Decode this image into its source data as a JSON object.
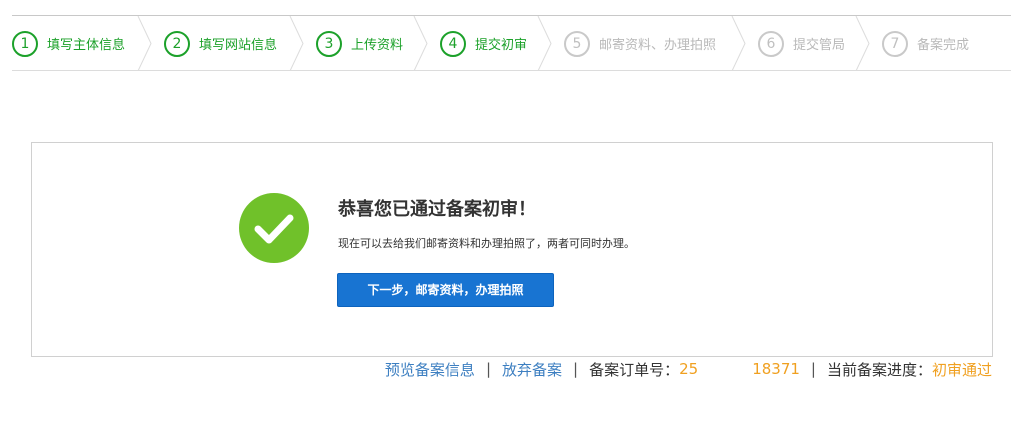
{
  "steps": [
    {
      "num": "1",
      "label": "填写主体信息",
      "status": "done"
    },
    {
      "num": "2",
      "label": "填写网站信息",
      "status": "done"
    },
    {
      "num": "3",
      "label": "上传资料",
      "status": "done"
    },
    {
      "num": "4",
      "label": "提交初审",
      "status": "done"
    },
    {
      "num": "5",
      "label": "邮寄资料、办理拍照",
      "status": "pending"
    },
    {
      "num": "6",
      "label": "提交管局",
      "status": "pending"
    },
    {
      "num": "7",
      "label": "备案完成",
      "status": "pending"
    }
  ],
  "result": {
    "icon": "check-circle-icon",
    "title": "恭喜您已通过备案初审！",
    "description": "现在可以去给我们邮寄资料和办理拍照了，两者可同时办理。",
    "next_button": "下一步，邮寄资料，办理拍照"
  },
  "footer": {
    "preview_link": "预览备案信息",
    "abandon_link": "放弃备案",
    "order_label": "备案订单号：",
    "order_prefix": "25",
    "order_suffix": "18371",
    "progress_label": "当前备案进度：",
    "progress_value": "初审通过",
    "separator": "|"
  },
  "colors": {
    "done": "#1ca12a",
    "pending": "#b9b9b9",
    "success": "#70c12a",
    "primary_button": "#1874d2",
    "link": "#3d7fc1",
    "highlight": "#f0a020"
  }
}
